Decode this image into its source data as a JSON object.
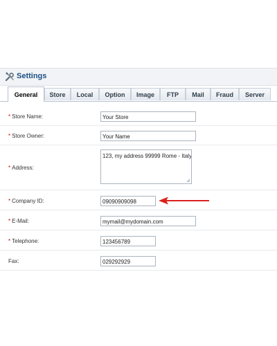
{
  "header": {
    "title": "Settings",
    "icon": "tools-icon"
  },
  "tabs": [
    {
      "label": "General",
      "active": true
    },
    {
      "label": "Store",
      "active": false
    },
    {
      "label": "Local",
      "active": false
    },
    {
      "label": "Option",
      "active": false
    },
    {
      "label": "Image",
      "active": false
    },
    {
      "label": "FTP",
      "active": false
    },
    {
      "label": "Mail",
      "active": false
    },
    {
      "label": "Fraud",
      "active": false
    },
    {
      "label": "Server",
      "active": false
    }
  ],
  "form": {
    "store_name": {
      "label": "Store Name:",
      "required": "*",
      "value": "Your Store"
    },
    "store_owner": {
      "label": "Store Owner:",
      "required": "*",
      "value": "Your Name"
    },
    "address": {
      "label": "Address:",
      "required": "*",
      "value": "123, my address 99999 Rome - Italy"
    },
    "company_id": {
      "label": "Company ID:",
      "required": "*",
      "value": "09090909098"
    },
    "email": {
      "label": "E-Mail:",
      "required": "*",
      "value": "mymail@mydomain.com"
    },
    "telephone": {
      "label": "Telephone:",
      "required": "*",
      "value": "123456789"
    },
    "fax": {
      "label": "Fax:",
      "value": "029292929"
    }
  },
  "colors": {
    "accent": "#1b4f82",
    "required": "#cc0000",
    "annotation_arrow": "#d9221c"
  }
}
